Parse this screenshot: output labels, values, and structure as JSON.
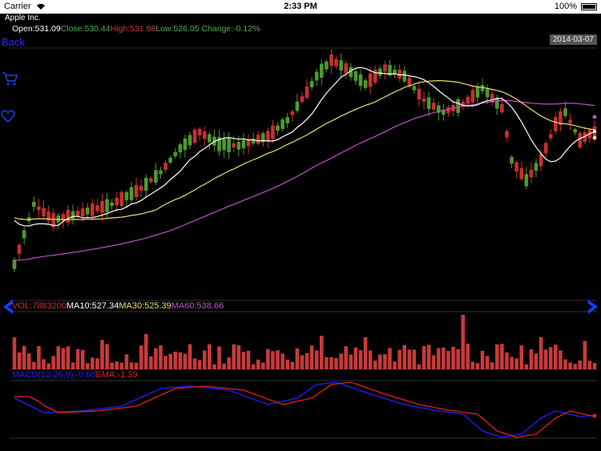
{
  "status_bar": {
    "carrier": "Carrier",
    "time": "2:33 PM",
    "battery": "100%"
  },
  "stock": {
    "company": "Apple Inc.",
    "open_text": "Open:531.09",
    "close_text": "Close:530.44",
    "high_text": "High:531.98",
    "low_text": "Low:526.05",
    "change_text": "Change:-0.12%"
  },
  "nav": {
    "back_label": "Back"
  },
  "chart": {
    "date_label": "2014-03-07",
    "vol_text": "VOL:7883200",
    "ma10_text": "MA10:527.34",
    "ma30_text": "MA30:525.39",
    "ma60_text": "MA60:538.66",
    "macd_text": "MACD(12,26,9):-0.60",
    "ema_text": "EMA:-1.39"
  },
  "colors": {
    "up": "#4e9a2e",
    "down": "#c73030",
    "ma10": "#ffffff",
    "ma30": "#e8e06a",
    "ma60": "#c050c8",
    "macd": "#2020ff",
    "ema": "#e02020",
    "volume": "#c83a3a",
    "accent_blue": "#1540ff"
  },
  "icons": {
    "cart": "cart-icon",
    "heart": "heart-icon",
    "prev": "arrow-left-icon",
    "next": "arrow-right-icon"
  }
}
